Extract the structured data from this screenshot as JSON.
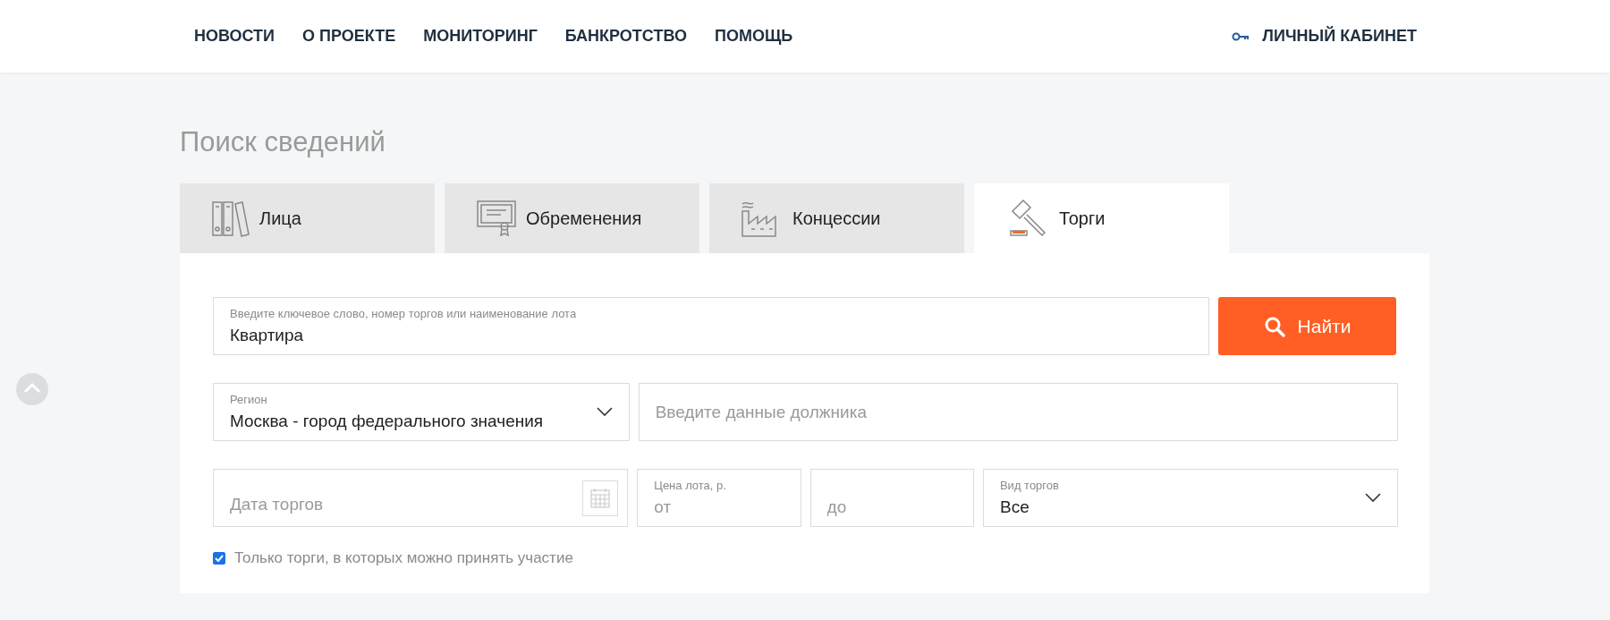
{
  "nav": {
    "items": [
      {
        "label": "НОВОСТИ"
      },
      {
        "label": "О ПРОЕКТЕ"
      },
      {
        "label": "МОНИТОРИНГ"
      },
      {
        "label": "БАНКРОТСТВО"
      },
      {
        "label": "ПОМОЩЬ"
      }
    ],
    "account": "ЛИЧНЫЙ КАБИНЕТ"
  },
  "title": "Поиск сведений",
  "tabs": [
    {
      "label": "Лица",
      "selected": false
    },
    {
      "label": "Обременения",
      "selected": false
    },
    {
      "label": "Концессии",
      "selected": false
    },
    {
      "label": "Торги",
      "selected": true
    }
  ],
  "search": {
    "label": "Введите ключевое слово, номер торгов или наименование лота",
    "value": "Квартира",
    "button": "Найти"
  },
  "region": {
    "label": "Регион",
    "value": "Москва - город федерального значения"
  },
  "debtor": {
    "placeholder": "Введите данные должника"
  },
  "date": {
    "placeholder": "Дата торгов"
  },
  "price": {
    "label": "Цена лота, р.",
    "from_placeholder": "от",
    "to_placeholder": "до"
  },
  "auction_type": {
    "label": "Вид торгов",
    "value": "Все"
  },
  "only_open": {
    "label": "Только торги, в которых можно принять участие",
    "checked": true
  }
}
